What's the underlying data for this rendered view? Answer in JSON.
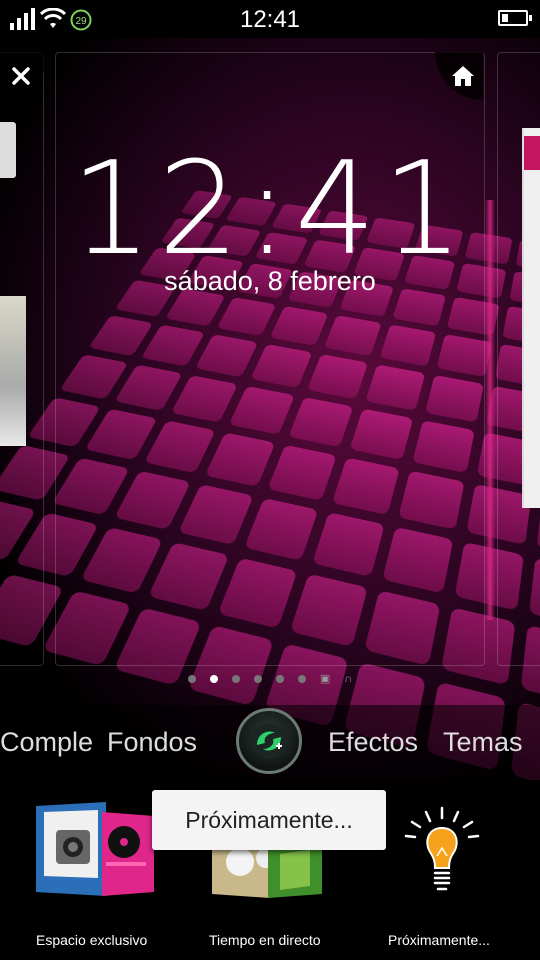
{
  "status_bar": {
    "time": "12:41",
    "notification_badge": "29",
    "battery_level": 0.25,
    "icons": [
      "signal-icon",
      "wifi-icon",
      "notification-badge-icon",
      "battery-icon"
    ]
  },
  "lockscreen": {
    "clock": "12:41",
    "date": "sábado, 8 febrero"
  },
  "pager": {
    "page_count": 6,
    "active_index": 1,
    "extra_icons": [
      "image-icon",
      "headphones-icon"
    ]
  },
  "tabs": {
    "items": [
      {
        "label": "Comple"
      },
      {
        "label": "Fondos"
      },
      {
        "label": "Efectos"
      },
      {
        "label": "Temas"
      }
    ]
  },
  "bottom_items": [
    {
      "label": "Espacio exclusivo",
      "icon": "exclusive-space-icon"
    },
    {
      "label": "Tiempo en directo",
      "icon": "live-weather-icon"
    },
    {
      "label": "Próximamente...",
      "icon": "lightbulb-icon"
    }
  ],
  "tooltip": {
    "text": "Próximamente..."
  },
  "colors": {
    "accent_pink": "#b01a76",
    "fab_green": "#2fd16a"
  }
}
